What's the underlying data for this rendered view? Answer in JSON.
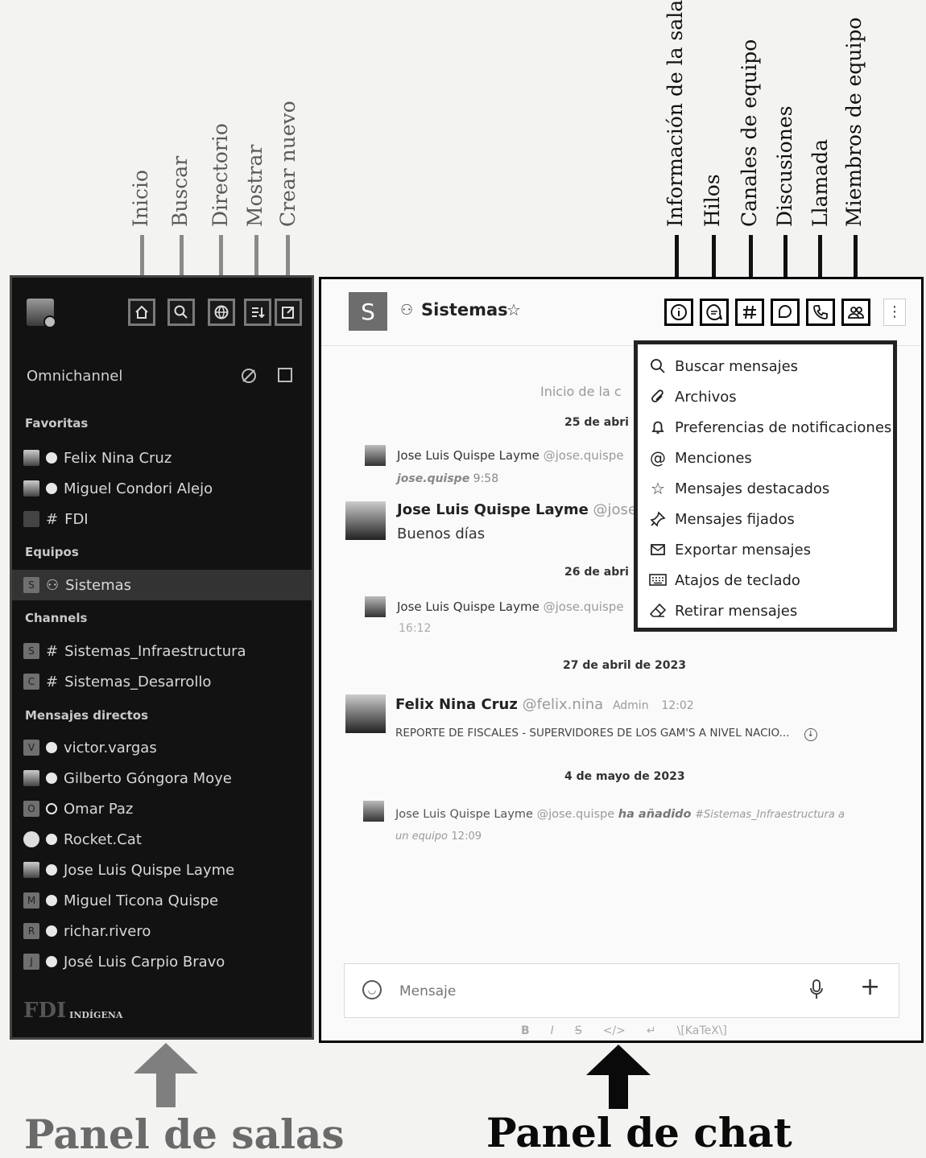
{
  "annotations": {
    "left": [
      "Inicio",
      "Buscar",
      "Directorio",
      "Mostrar",
      "Crear nuevo"
    ],
    "right": [
      "Información de la sala",
      "Hilos",
      "Canales de equipo",
      "Discusiones",
      "Llamada",
      "Miembros de equipo"
    ],
    "bottom_left": "Panel de salas",
    "bottom_right": "Panel de chat"
  },
  "sidebar": {
    "omnichannel": "Omnichannel",
    "sections": {
      "favorites": "Favoritas",
      "teams": "Equipos",
      "channels": "Channels",
      "direct": "Mensajes directos"
    },
    "favorites": [
      {
        "label": "Felix Nina Cruz",
        "avatar": "",
        "status": "away"
      },
      {
        "label": "Miguel Condori Alejo",
        "avatar": "",
        "status": "away"
      },
      {
        "label": "FDI",
        "avatar": "",
        "status": "hash"
      }
    ],
    "teams": [
      {
        "label": "Sistemas",
        "avatar": "S"
      }
    ],
    "channels": [
      {
        "label": "Sistemas_Infraestructura",
        "avatar": "S"
      },
      {
        "label": "Sistemas_Desarrollo",
        "avatar": "C"
      }
    ],
    "direct": [
      {
        "label": "victor.vargas",
        "avatar": "V",
        "status": "away"
      },
      {
        "label": "Gilberto Góngora Moye",
        "avatar": "",
        "status": "away"
      },
      {
        "label": "Omar Paz",
        "avatar": "O",
        "status": "offline"
      },
      {
        "label": "Rocket.Cat",
        "avatar": "",
        "status": "online"
      },
      {
        "label": "Jose Luis Quispe Layme",
        "avatar": "",
        "status": "online"
      },
      {
        "label": "Miguel Ticona Quispe",
        "avatar": "M",
        "status": "online"
      },
      {
        "label": "richar.rivero",
        "avatar": "R",
        "status": "away"
      },
      {
        "label": "José Luis Carpio Bravo",
        "avatar": "J",
        "status": "away"
      }
    ],
    "logo_text": "FDI",
    "logo_sub": "INDÍGENA"
  },
  "chat": {
    "room_avatar": "S",
    "room_name": "Sistemas",
    "start_text": "Inicio de la c",
    "dates": [
      "25 de abri",
      "26 de abri",
      "27 de abril de 2023",
      "4 de mayo de 2023"
    ],
    "messages": {
      "m1": {
        "author": "Jose Luis Quispe Layme",
        "username": "@jose.quispe",
        "sub": "jose.quispe",
        "time": "9:58"
      },
      "m2": {
        "author": "Jose Luis Quispe Layme",
        "username": "@jose.",
        "text": "Buenos días"
      },
      "m3": {
        "author": "Jose Luis Quispe Layme",
        "username": "@jose.quispe",
        "time": "16:12"
      },
      "m4": {
        "author": "Felix Nina Cruz",
        "username": "@felix.nina",
        "role": "Admin",
        "time": "12:02",
        "text": "REPORTE DE FISCALES - SUPERVIDORES DE LOS GAM'S A NIVEL NACIO..."
      },
      "m5": {
        "author": "Jose Luis Quispe Layme",
        "username": "@jose.quispe",
        "action": "ha añadido",
        "channel": "#Sistemas_Infraestructura a",
        "tail": "un equipo",
        "time": "12:09"
      }
    },
    "menu": [
      "Buscar mensajes",
      "Archivos",
      "Preferencias de notificaciones",
      "Menciones",
      "Mensajes destacados",
      "Mensajes fijados",
      "Exportar mensajes",
      "Atajos de teclado",
      "Retirar mensajes"
    ],
    "composer": {
      "placeholder": "Mensaje",
      "format": [
        "B",
        "I",
        "S",
        "</>",
        "↵",
        "\\[KaTeX\\]"
      ]
    }
  }
}
